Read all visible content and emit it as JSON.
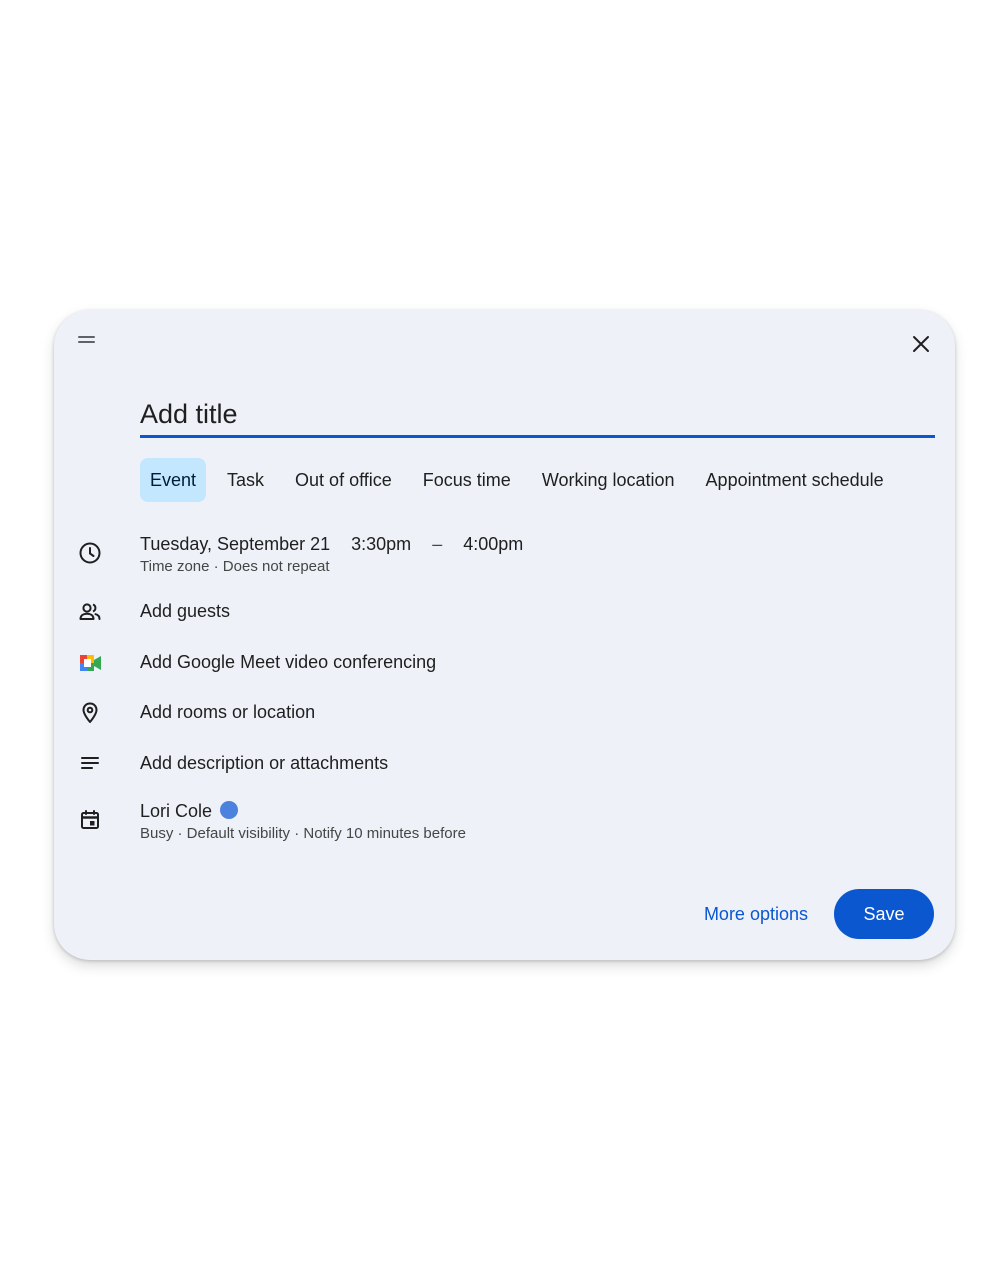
{
  "dialog": {
    "title_placeholder": "Add title",
    "tabs": [
      {
        "label": "Event",
        "active": true
      },
      {
        "label": "Task"
      },
      {
        "label": "Out of office"
      },
      {
        "label": "Focus time"
      },
      {
        "label": "Working location"
      },
      {
        "label": "Appointment schedule"
      }
    ],
    "datetime": {
      "date": "Tuesday, September 21",
      "start": "3:30pm",
      "separator": "–",
      "end": "4:00pm",
      "details": "Time zone · Does not repeat"
    },
    "guests_label": "Add guests",
    "meet_label": "Add Google Meet video conferencing",
    "location_label": "Add rooms or location",
    "description_label": "Add description or attachments",
    "calendar": {
      "owner": "Lori Cole",
      "color": "#4c82de",
      "details": "Busy · Default visibility · Notify 10 minutes before"
    },
    "footer": {
      "more_options": "More options",
      "save": "Save"
    }
  },
  "colors": {
    "accent": "#0b57d0",
    "active_tab_bg": "#c2e7ff",
    "dialog_bg": "#eef1f8"
  },
  "icons": [
    "drag-handle-icon",
    "close-icon",
    "clock-icon",
    "people-icon",
    "google-meet-icon",
    "location-pin-icon",
    "notes-icon",
    "calendar-icon"
  ]
}
